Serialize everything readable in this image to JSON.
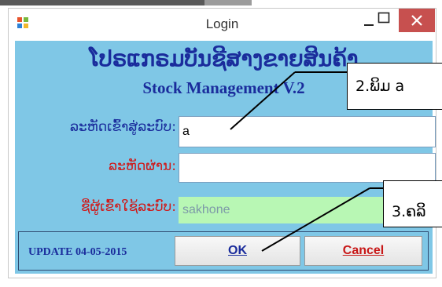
{
  "window": {
    "title": "Login",
    "controls": [
      "minimize-icon",
      "maximize-icon",
      "close-icon"
    ]
  },
  "header": {
    "lao_title": "ໂປຣແກຣມບັນຊີສາງຂາຍສິນຄ້າ",
    "english_title": "Stock Management V.2"
  },
  "form": {
    "username_label": "ລະຫັດເຂົ້າສູ່ລະບົບ:",
    "username_value": "a",
    "password_label": "ລະຫັດຜ່ານ:",
    "password_value": "",
    "user_name_label": "ຊື່ຜູ້ເຂົ້າໃຊ້ລະບົບ:",
    "user_name_value": "sakhone"
  },
  "footer": {
    "update_text": "UPDATE 04-05-2015",
    "ok_label": "OK",
    "cancel_label": "Cancel"
  },
  "annotations": {
    "callout_1": "2.ພິມ a",
    "callout_2": "3.ຄລິ"
  },
  "colors": {
    "client_background": "#7fc7e6",
    "title_blue": "#1a2c9c",
    "label_red": "#d01818",
    "name_field_green": "#b8f7b4",
    "close_button_red": "#c7504f"
  }
}
